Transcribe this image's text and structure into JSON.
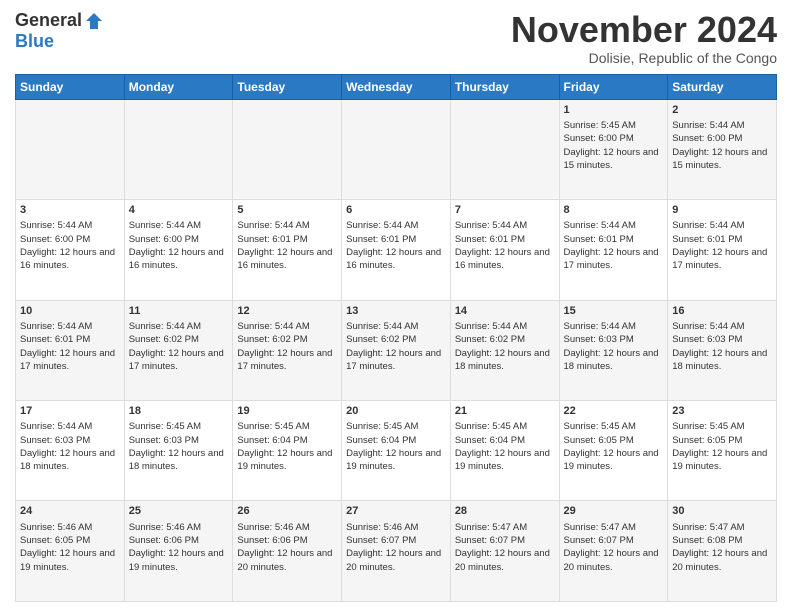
{
  "logo": {
    "general": "General",
    "blue": "Blue"
  },
  "header": {
    "month": "November 2024",
    "location": "Dolisie, Republic of the Congo"
  },
  "weekdays": [
    "Sunday",
    "Monday",
    "Tuesday",
    "Wednesday",
    "Thursday",
    "Friday",
    "Saturday"
  ],
  "weeks": [
    [
      {
        "day": "",
        "content": ""
      },
      {
        "day": "",
        "content": ""
      },
      {
        "day": "",
        "content": ""
      },
      {
        "day": "",
        "content": ""
      },
      {
        "day": "",
        "content": ""
      },
      {
        "day": "1",
        "content": "Sunrise: 5:45 AM\nSunset: 6:00 PM\nDaylight: 12 hours and 15 minutes."
      },
      {
        "day": "2",
        "content": "Sunrise: 5:44 AM\nSunset: 6:00 PM\nDaylight: 12 hours and 15 minutes."
      }
    ],
    [
      {
        "day": "3",
        "content": "Sunrise: 5:44 AM\nSunset: 6:00 PM\nDaylight: 12 hours and 16 minutes."
      },
      {
        "day": "4",
        "content": "Sunrise: 5:44 AM\nSunset: 6:00 PM\nDaylight: 12 hours and 16 minutes."
      },
      {
        "day": "5",
        "content": "Sunrise: 5:44 AM\nSunset: 6:01 PM\nDaylight: 12 hours and 16 minutes."
      },
      {
        "day": "6",
        "content": "Sunrise: 5:44 AM\nSunset: 6:01 PM\nDaylight: 12 hours and 16 minutes."
      },
      {
        "day": "7",
        "content": "Sunrise: 5:44 AM\nSunset: 6:01 PM\nDaylight: 12 hours and 16 minutes."
      },
      {
        "day": "8",
        "content": "Sunrise: 5:44 AM\nSunset: 6:01 PM\nDaylight: 12 hours and 17 minutes."
      },
      {
        "day": "9",
        "content": "Sunrise: 5:44 AM\nSunset: 6:01 PM\nDaylight: 12 hours and 17 minutes."
      }
    ],
    [
      {
        "day": "10",
        "content": "Sunrise: 5:44 AM\nSunset: 6:01 PM\nDaylight: 12 hours and 17 minutes."
      },
      {
        "day": "11",
        "content": "Sunrise: 5:44 AM\nSunset: 6:02 PM\nDaylight: 12 hours and 17 minutes."
      },
      {
        "day": "12",
        "content": "Sunrise: 5:44 AM\nSunset: 6:02 PM\nDaylight: 12 hours and 17 minutes."
      },
      {
        "day": "13",
        "content": "Sunrise: 5:44 AM\nSunset: 6:02 PM\nDaylight: 12 hours and 17 minutes."
      },
      {
        "day": "14",
        "content": "Sunrise: 5:44 AM\nSunset: 6:02 PM\nDaylight: 12 hours and 18 minutes."
      },
      {
        "day": "15",
        "content": "Sunrise: 5:44 AM\nSunset: 6:03 PM\nDaylight: 12 hours and 18 minutes."
      },
      {
        "day": "16",
        "content": "Sunrise: 5:44 AM\nSunset: 6:03 PM\nDaylight: 12 hours and 18 minutes."
      }
    ],
    [
      {
        "day": "17",
        "content": "Sunrise: 5:44 AM\nSunset: 6:03 PM\nDaylight: 12 hours and 18 minutes."
      },
      {
        "day": "18",
        "content": "Sunrise: 5:45 AM\nSunset: 6:03 PM\nDaylight: 12 hours and 18 minutes."
      },
      {
        "day": "19",
        "content": "Sunrise: 5:45 AM\nSunset: 6:04 PM\nDaylight: 12 hours and 19 minutes."
      },
      {
        "day": "20",
        "content": "Sunrise: 5:45 AM\nSunset: 6:04 PM\nDaylight: 12 hours and 19 minutes."
      },
      {
        "day": "21",
        "content": "Sunrise: 5:45 AM\nSunset: 6:04 PM\nDaylight: 12 hours and 19 minutes."
      },
      {
        "day": "22",
        "content": "Sunrise: 5:45 AM\nSunset: 6:05 PM\nDaylight: 12 hours and 19 minutes."
      },
      {
        "day": "23",
        "content": "Sunrise: 5:45 AM\nSunset: 6:05 PM\nDaylight: 12 hours and 19 minutes."
      }
    ],
    [
      {
        "day": "24",
        "content": "Sunrise: 5:46 AM\nSunset: 6:05 PM\nDaylight: 12 hours and 19 minutes."
      },
      {
        "day": "25",
        "content": "Sunrise: 5:46 AM\nSunset: 6:06 PM\nDaylight: 12 hours and 19 minutes."
      },
      {
        "day": "26",
        "content": "Sunrise: 5:46 AM\nSunset: 6:06 PM\nDaylight: 12 hours and 20 minutes."
      },
      {
        "day": "27",
        "content": "Sunrise: 5:46 AM\nSunset: 6:07 PM\nDaylight: 12 hours and 20 minutes."
      },
      {
        "day": "28",
        "content": "Sunrise: 5:47 AM\nSunset: 6:07 PM\nDaylight: 12 hours and 20 minutes."
      },
      {
        "day": "29",
        "content": "Sunrise: 5:47 AM\nSunset: 6:07 PM\nDaylight: 12 hours and 20 minutes."
      },
      {
        "day": "30",
        "content": "Sunrise: 5:47 AM\nSunset: 6:08 PM\nDaylight: 12 hours and 20 minutes."
      }
    ]
  ]
}
